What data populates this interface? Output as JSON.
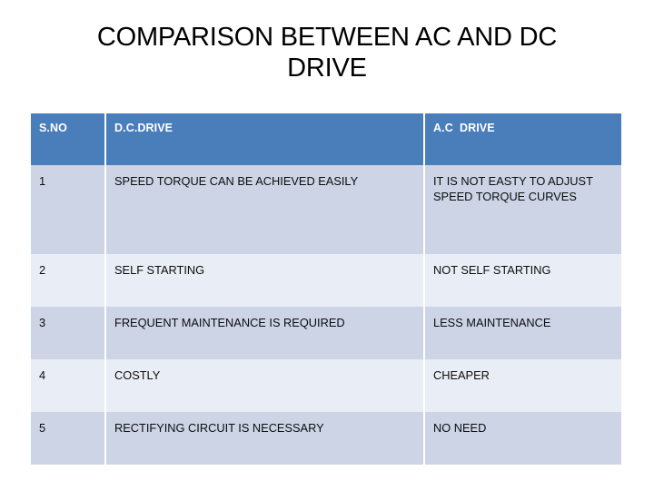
{
  "slide": {
    "title": "COMPARISON BETWEEN AC AND DC\nDRIVE",
    "colors": {
      "header_fill": "#4a7ebb",
      "header_text": "#ffffff",
      "row_band_dark": "#ccd4e5",
      "row_band_light": "#e9edf5",
      "body_text": "#0d0d0d",
      "background": "#ffffff",
      "gridline": "#ffffff"
    }
  },
  "table": {
    "headers": [
      "S.NO",
      "D.C.DRIVE",
      "A.C  DRIVE"
    ],
    "rows": [
      {
        "sno": "1",
        "dc": "SPEED TORQUE CAN BE ACHIEVED EASILY",
        "ac": "IT IS NOT EASTY TO ADJUST SPEED TORQUE CURVES"
      },
      {
        "sno": "2",
        "dc": "SELF STARTING",
        "ac": "NOT SELF STARTING"
      },
      {
        "sno": "3",
        "dc": "FREQUENT MAINTENANCE IS REQUIRED",
        "ac": "LESS MAINTENANCE"
      },
      {
        "sno": "4",
        "dc": "COSTLY",
        "ac": "CHEAPER"
      },
      {
        "sno": "5",
        "dc": "RECTIFYING CIRCUIT IS NECESSARY",
        "ac": "NO NEED"
      }
    ]
  }
}
